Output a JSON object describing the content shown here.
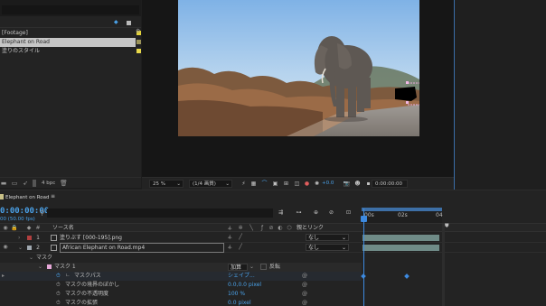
{
  "project": {
    "items": [
      {
        "label": "[Footage]",
        "swatch": "#e3d23a",
        "selected": false
      },
      {
        "label": "Elephant on Road",
        "swatch": "#c9c187",
        "selected": true
      },
      {
        "label": "塗りのスタイル",
        "swatch": "#e8d84a",
        "selected": false
      }
    ],
    "bpc": "4 bpc"
  },
  "viewer_toolbar": {
    "zoom": "25 %",
    "resolution": "(1/4 画質)",
    "exposure": "+0.0",
    "timecode": "0:00:00:00"
  },
  "timeline": {
    "comp_name": "Elephant on Road",
    "menu_glyph": "≡",
    "timecode": "0:00:00:00",
    "fps": "00 (50.00 fps)",
    "columns": {
      "source_name": "ソース名",
      "parent_link": "親とリンク"
    },
    "ruler": {
      "start": "00s",
      "mid": "02s",
      "end": "04"
    },
    "layers": [
      {
        "num": "1",
        "name": "塗りぶす [000-195].png",
        "parent": "なし"
      },
      {
        "num": "2",
        "name": "African Elephant on Road.mp4",
        "parent": "なし"
      }
    ],
    "mask_group": "マスク",
    "mask_name": "マスク 1",
    "mask_mode": "加算",
    "mask_invert": "反転",
    "mask_props": [
      {
        "label": "マスクパス",
        "value": "シェイプ..."
      },
      {
        "label": "マスクの境界のぼかし",
        "value": "0.0,0.0 pixel"
      },
      {
        "label": "マスクの不透明度",
        "value": "100 %"
      },
      {
        "label": "マスクの拡張",
        "value": "0.0 pixel"
      }
    ]
  },
  "colors": {
    "accent": "#4aa1e8",
    "selected_row": "#c6c6c6",
    "layer_bar": "#6f8b87"
  }
}
